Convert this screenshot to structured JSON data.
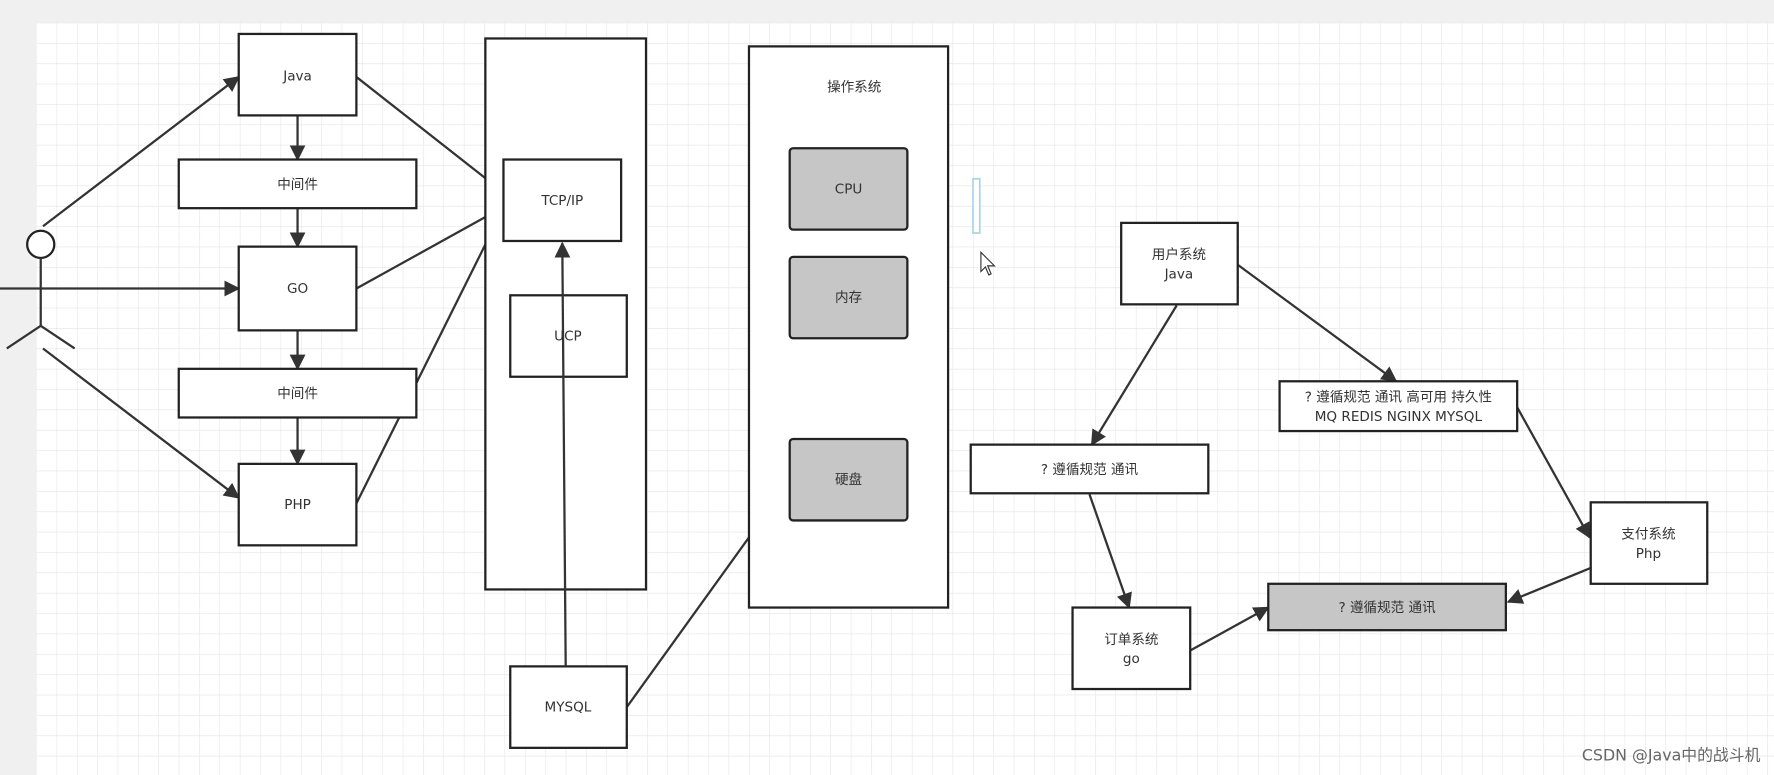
{
  "left": {
    "java": "Java",
    "middleware1": "中间件",
    "go": "GO",
    "middleware2": "中间件",
    "php": "PHP"
  },
  "network": {
    "tcpip": "TCP/IP",
    "ucp": "UCP",
    "mysql": "MYSQL"
  },
  "os": {
    "title": "操作系统",
    "cpu": "CPU",
    "memory": "内存",
    "disk": "硬盘"
  },
  "right": {
    "user_system": [
      "用户系统",
      "Java"
    ],
    "middleware_box": [
      "? 遵循规范 通讯 高可用 持久性",
      "MQ REDIS NGINX MYSQL"
    ],
    "protocol_box": "? 遵循规范 通讯",
    "pay_system": [
      "支付系统",
      "Php"
    ],
    "protocol_box_gray": "? 遵循规范 通讯",
    "order_system": [
      "订单系统",
      "go"
    ]
  },
  "watermark": "CSDN @Java中的战斗机",
  "colors": {
    "shaded_box": "#c6c6c6",
    "stroke": "#222222",
    "grid": "#e6e6e6"
  }
}
